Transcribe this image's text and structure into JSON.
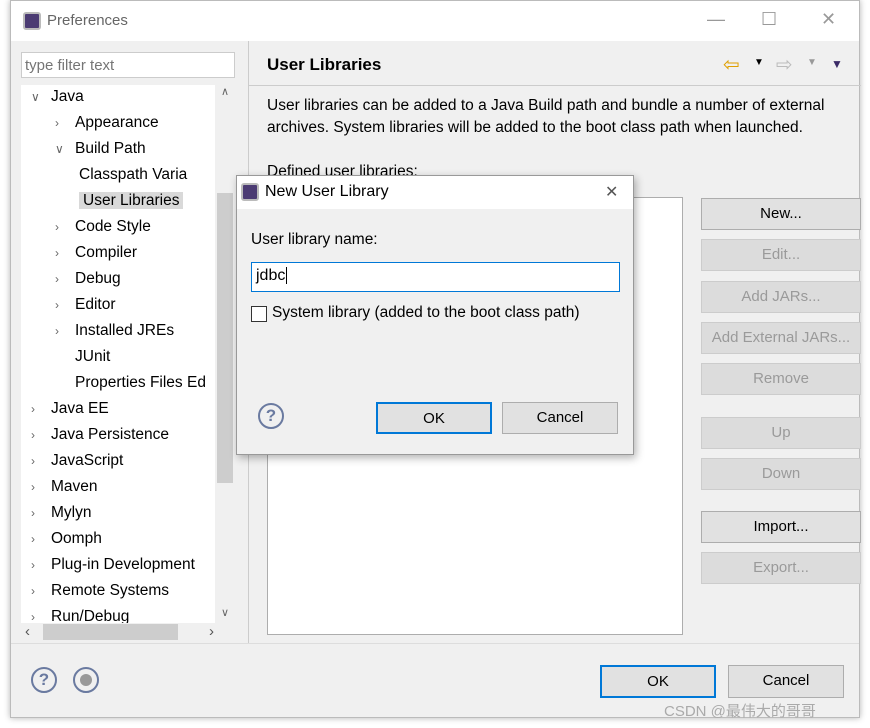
{
  "window": {
    "title": "Preferences",
    "minimize": "—",
    "maximize": "☐",
    "close": "✕"
  },
  "filter": {
    "placeholder": "type filter text"
  },
  "tree": [
    {
      "label": "Java",
      "indent": 0,
      "arrow": "∨"
    },
    {
      "label": "Appearance",
      "indent": 1,
      "arrow": "›"
    },
    {
      "label": "Build Path",
      "indent": 1,
      "arrow": "∨"
    },
    {
      "label": "Classpath Varia",
      "indent": 2,
      "arrow": ""
    },
    {
      "label": "User Libraries",
      "indent": 2,
      "arrow": "",
      "selected": true
    },
    {
      "label": "Code Style",
      "indent": 1,
      "arrow": "›"
    },
    {
      "label": "Compiler",
      "indent": 1,
      "arrow": "›"
    },
    {
      "label": "Debug",
      "indent": 1,
      "arrow": "›"
    },
    {
      "label": "Editor",
      "indent": 1,
      "arrow": "›"
    },
    {
      "label": "Installed JREs",
      "indent": 1,
      "arrow": "›"
    },
    {
      "label": "JUnit",
      "indent": 1,
      "arrow": " "
    },
    {
      "label": "Properties Files Ed",
      "indent": 1,
      "arrow": " "
    },
    {
      "label": "Java EE",
      "indent": 0,
      "arrow": "›"
    },
    {
      "label": "Java Persistence",
      "indent": 0,
      "arrow": "›"
    },
    {
      "label": "JavaScript",
      "indent": 0,
      "arrow": "›"
    },
    {
      "label": "Maven",
      "indent": 0,
      "arrow": "›"
    },
    {
      "label": "Mylyn",
      "indent": 0,
      "arrow": "›"
    },
    {
      "label": "Oomph",
      "indent": 0,
      "arrow": "›"
    },
    {
      "label": "Plug-in Development",
      "indent": 0,
      "arrow": "›"
    },
    {
      "label": "Remote Systems",
      "indent": 0,
      "arrow": "›"
    },
    {
      "label": "Run/Debug",
      "indent": 0,
      "arrow": "›"
    }
  ],
  "page": {
    "title": "User Libraries",
    "description": "User libraries can be added to a Java Build path and bundle a number of external archives. System libraries will be added to the boot class path when launched.",
    "list_label": "Defined user libraries:",
    "buttons": [
      {
        "label": "New...",
        "enabled": true
      },
      {
        "label": "Edit...",
        "enabled": false
      },
      {
        "label": "Add JARs...",
        "enabled": false
      },
      {
        "label": "Add External JARs...",
        "enabled": false
      },
      {
        "label": "Remove",
        "enabled": false
      },
      {
        "label": "Up",
        "enabled": false
      },
      {
        "label": "Down",
        "enabled": false
      },
      {
        "label": "Import...",
        "enabled": true
      },
      {
        "label": "Export...",
        "enabled": false
      }
    ]
  },
  "footer": {
    "ok": "OK",
    "cancel": "Cancel"
  },
  "dialog": {
    "title": "New User Library",
    "name_label": "User library name:",
    "name_value": "jdbc",
    "system_checkbox": "System library (added to the boot class path)",
    "system_checked": false,
    "ok": "OK",
    "cancel": "Cancel",
    "close": "✕"
  },
  "watermark": "CSDN @最伟大的哥哥",
  "colors": {
    "focus": "#0078d7",
    "icon": "#4b3b73"
  }
}
